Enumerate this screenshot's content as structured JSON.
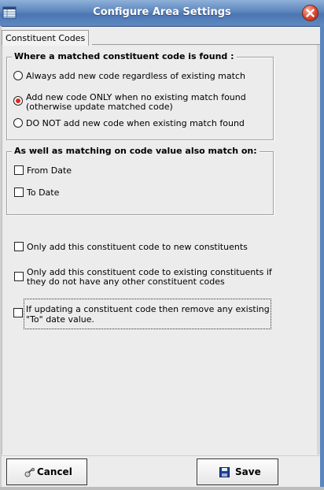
{
  "window": {
    "title": "Configure Area Settings",
    "app_icon": "table-icon",
    "close_icon": "close-icon",
    "title_bar_color": "#5b85bd",
    "close_color": "#d8472f"
  },
  "tabs": [
    {
      "label": "Constituent Codes",
      "selected": true
    }
  ],
  "match_found_group": {
    "legend": "Where a matched constituent code is found :",
    "options": [
      {
        "label": "Always add new code regardless of existing match",
        "selected": false
      },
      {
        "label_line1": "Add new code ONLY when no existing match found",
        "label_line2": "(otherwise update matched code)",
        "selected": true
      },
      {
        "label": "DO NOT add new code when existing match found",
        "selected": false
      }
    ],
    "selected_color": "#e0261b"
  },
  "also_match_group": {
    "legend": "As well as matching on code value also match on:",
    "options": [
      {
        "label": "From Date",
        "checked": false
      },
      {
        "label": "To Date",
        "checked": false
      }
    ]
  },
  "standalone_checks": [
    {
      "label": "Only add this constituent code to new constituents",
      "checked": false
    },
    {
      "label_line1": "Only add this constituent code to existing constituents if",
      "label_line2": "they do not have any other constituent codes",
      "checked": false
    },
    {
      "label_line1": "If updating a constituent code then remove any existing",
      "label_line2": "\"To\" date value.",
      "checked": false,
      "focused": true
    }
  ],
  "footer": {
    "cancel": {
      "label": "Cancel",
      "icon": "cancel-icon"
    },
    "save": {
      "label": "Save",
      "icon": "save-disk-icon",
      "icon_color": "#1f3f8f"
    }
  }
}
